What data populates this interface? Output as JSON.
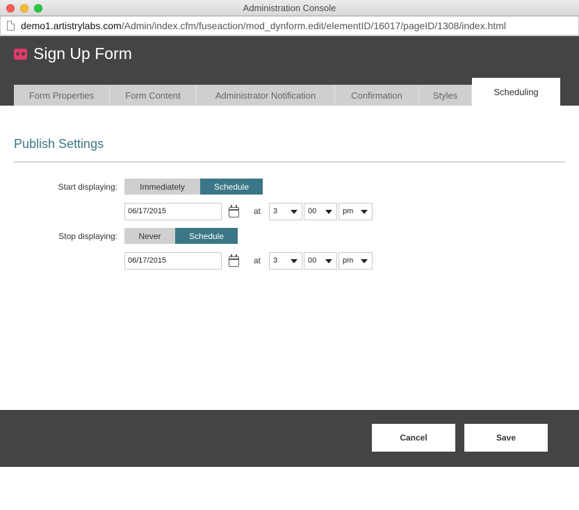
{
  "window": {
    "title": "Administration Console"
  },
  "url": {
    "host": "demo1.artistrylabs.com",
    "path": "/Admin/index.cfm/fuseaction/mod_dynform.edit/elementID/16017/pageID/1308/index.html"
  },
  "header": {
    "title": "Sign Up Form",
    "logo_icon": "mask-logo-icon"
  },
  "tabs": [
    {
      "label": "Form Properties",
      "active": false
    },
    {
      "label": "Form Content",
      "active": false
    },
    {
      "label": "Administrator Notification",
      "active": false
    },
    {
      "label": "Confirmation",
      "active": false
    },
    {
      "label": "Styles",
      "active": false
    },
    {
      "label": "Scheduling",
      "active": true
    }
  ],
  "section": {
    "title": "Publish Settings"
  },
  "start": {
    "label": "Start displaying:",
    "options": [
      "Immediately",
      "Schedule"
    ],
    "selected": "Schedule",
    "date": "06/17/2015",
    "at": "at",
    "hour": "3",
    "minute": "00",
    "ampm": "pm"
  },
  "stop": {
    "label": "Stop displaying:",
    "options": [
      "Never",
      "Schedule"
    ],
    "selected": "Schedule",
    "date": "06/17/2015",
    "at": "at",
    "hour": "3",
    "minute": "00",
    "ampm": "pm"
  },
  "footer": {
    "cancel_label": "Cancel",
    "save_label": "Save"
  },
  "colors": {
    "accent": "#3a7686",
    "header_bg": "#444444",
    "brand": "#e13a6a"
  }
}
